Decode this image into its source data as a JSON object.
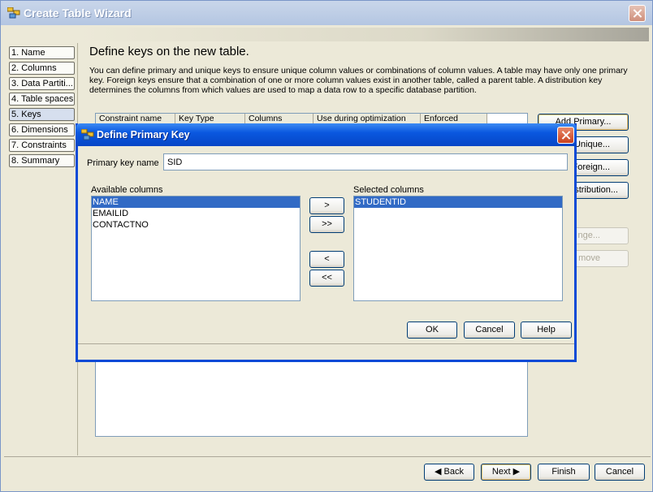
{
  "window": {
    "title": "Create Table Wizard",
    "steps": [
      {
        "label": "1. Name",
        "active": false
      },
      {
        "label": "2. Columns",
        "active": false
      },
      {
        "label": "3. Data Partiti...",
        "active": false
      },
      {
        "label": "4. Table spaces",
        "active": false
      },
      {
        "label": "5. Keys",
        "active": true
      },
      {
        "label": "6. Dimensions",
        "active": false
      },
      {
        "label": "7. Constraints",
        "active": false
      },
      {
        "label": "8. Summary",
        "active": false
      }
    ],
    "heading": "Define keys on the new table.",
    "description": "You can define primary and unique keys to ensure unique column values or combinations of column values. A table may have only one primary key. Foreign keys ensure that a combination of one or more column values exist in another table, called a parent table. A distribution key determines the columns from which values are used to map a data row to a specific database partition.",
    "table_headers": [
      "Constraint name",
      "Key Type",
      "Columns",
      "Use during optimization",
      "Enforced"
    ],
    "side_buttons": {
      "add_primary": "Add Primary...",
      "add_unique": "Unique...",
      "add_foreign": "Foreign...",
      "distribution": "stribution...",
      "change": "nge...",
      "remove": "move"
    },
    "nav": {
      "back": "◀ Back",
      "next": "Next ▶",
      "finish": "Finish",
      "cancel": "Cancel"
    }
  },
  "dialog": {
    "title": "Define Primary Key",
    "pk_name_label": "Primary key name",
    "pk_name_value": "SID",
    "available_label": "Available columns",
    "available": [
      "NAME",
      "EMAILID",
      "CONTACTNO"
    ],
    "available_selected": "NAME",
    "selected_label": "Selected columns",
    "selected": [
      "STUDENTID"
    ],
    "move_buttons": {
      "add": ">",
      "add_all": ">>",
      "remove": "<",
      "remove_all": "<<"
    },
    "buttons": {
      "ok": "OK",
      "cancel": "Cancel",
      "help": "Help"
    }
  },
  "colors": {
    "window_bg": "#ece9d8",
    "dialog_title": "#0a58e0",
    "selection": "#316ac5"
  }
}
